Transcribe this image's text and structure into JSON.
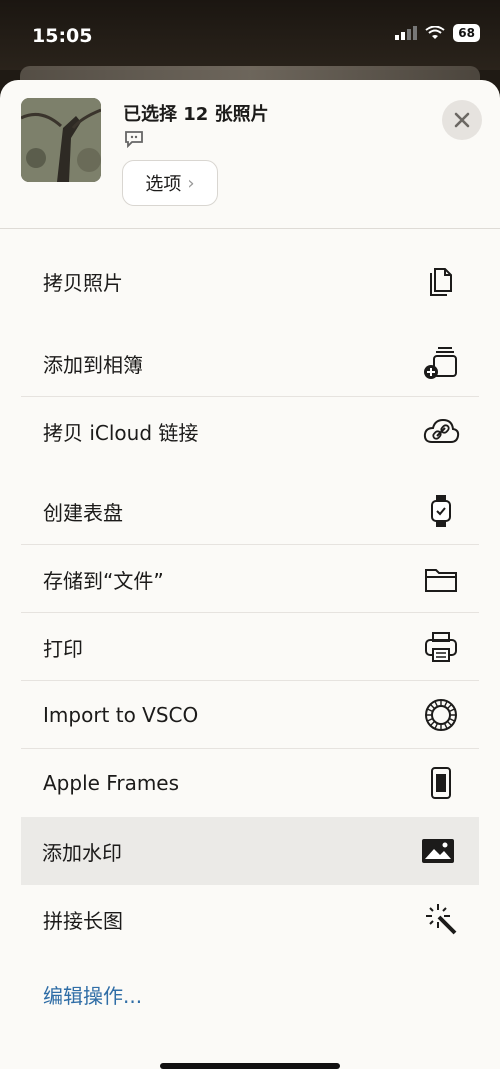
{
  "status_bar": {
    "time": "15:05",
    "battery": "68"
  },
  "header": {
    "title": "已选择 12 张照片",
    "options_label": "选项",
    "options_chevron": "›"
  },
  "menu": [
    {
      "label": "拷贝照片",
      "icon": "copy-icon"
    },
    {
      "label": "添加到相簿",
      "icon": "add-to-album-icon"
    },
    {
      "label": "拷贝 iCloud 链接",
      "icon": "icloud-link-icon"
    },
    {
      "label": "创建表盘",
      "icon": "watch-icon"
    },
    {
      "label": "存储到“文件”",
      "icon": "folder-icon"
    },
    {
      "label": "打印",
      "icon": "printer-icon"
    },
    {
      "label": "Import to VSCO",
      "icon": "vsco-icon"
    },
    {
      "label": "Apple Frames",
      "icon": "phone-frame-icon"
    },
    {
      "label": "添加水印",
      "icon": "image-icon",
      "highlighted": true
    },
    {
      "label": "拼接长图",
      "icon": "magic-wand-icon"
    }
  ],
  "edit_actions": "编辑操作...",
  "colors": {
    "accent": "#2f6da6",
    "sheet_bg": "#fbfaf7",
    "highlight": "#ebeae7"
  }
}
